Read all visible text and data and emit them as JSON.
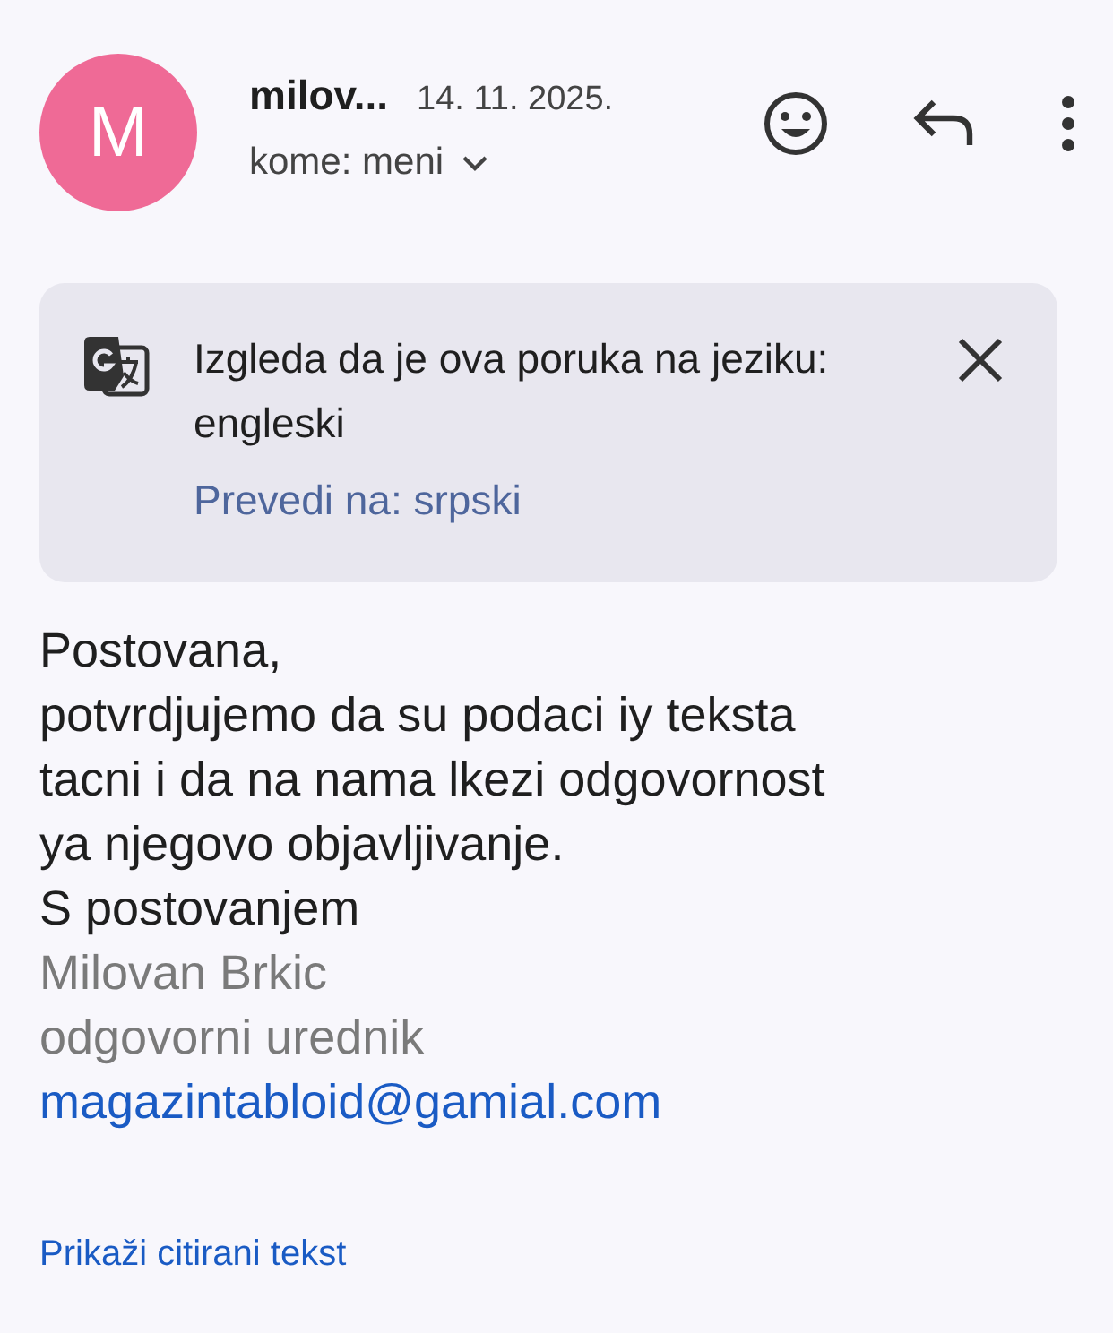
{
  "header": {
    "avatar_letter": "M",
    "sender": "milov...",
    "date": "14. 11. 2025.",
    "recipient": "kome: meni"
  },
  "translate_banner": {
    "message": "Izgleda da je ova poruka na jeziku: engleski",
    "action": "Prevedi na: srpski"
  },
  "body": [
    {
      "kind": "text",
      "text": "Postovana,"
    },
    {
      "kind": "text",
      "text": "potvrdjujemo da su podaci iy teksta"
    },
    {
      "kind": "text",
      "text": "tacni i da na nama lkezi odgovornost"
    },
    {
      "kind": "text",
      "text": "ya njegovo objavljivanje."
    },
    {
      "kind": "text",
      "text": "S postovanjem"
    },
    {
      "kind": "muted",
      "text": "Milovan Brkic"
    },
    {
      "kind": "muted",
      "text": "odgovorni urednik"
    },
    {
      "kind": "link",
      "text": "magazintabloid@gamial.com"
    }
  ],
  "show_quoted": "Prikaži citirani tekst"
}
